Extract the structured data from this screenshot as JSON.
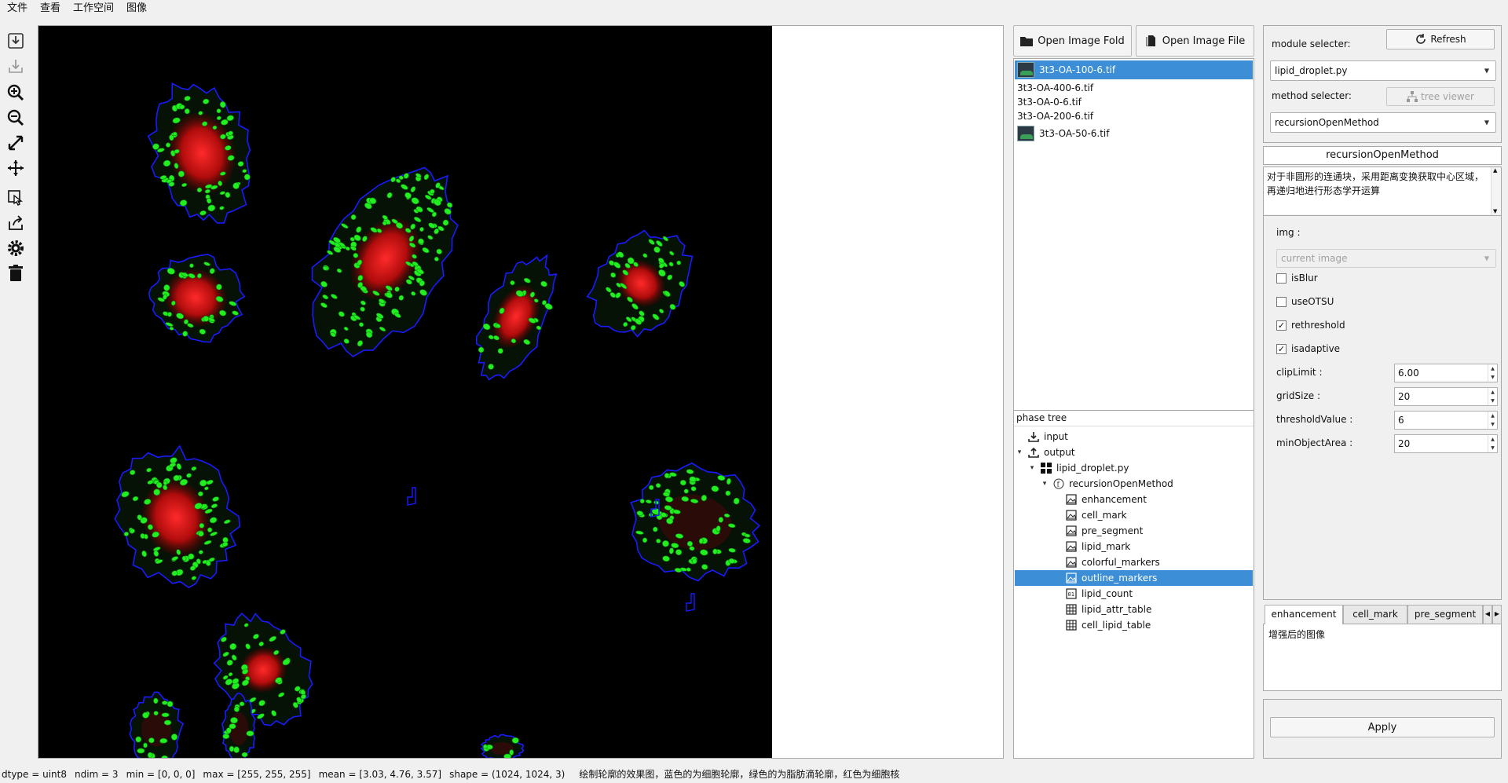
{
  "menu": [
    "文件",
    "查看",
    "工作空间",
    "图像"
  ],
  "toolbar": [
    {
      "icon": "import-icon"
    },
    {
      "icon": "export-icon"
    },
    {
      "icon": "zoom-in-icon"
    },
    {
      "icon": "zoom-out-icon"
    },
    {
      "icon": "fit-icon"
    },
    {
      "icon": "move-icon"
    },
    {
      "icon": "hand-select-icon"
    },
    {
      "icon": "share-icon"
    },
    {
      "icon": "settings-icon"
    },
    {
      "icon": "trash-icon"
    }
  ],
  "buttons": {
    "open_fold": "Open Image Fold",
    "open_file": "Open Image File"
  },
  "files": [
    {
      "name": "3t3-OA-100-6.tif",
      "thumb": true,
      "selected": true
    },
    {
      "name": "3t3-OA-400-6.tif",
      "thumb": false,
      "selected": false
    },
    {
      "name": "3t3-OA-0-6.tif",
      "thumb": false,
      "selected": false
    },
    {
      "name": "3t3-OA-200-6.tif",
      "thumb": false,
      "selected": false
    },
    {
      "name": "3t3-OA-50-6.tif",
      "thumb": true,
      "selected": false
    }
  ],
  "phase_tree": {
    "header": "phase tree",
    "nodes": [
      {
        "label": "input",
        "icon": "import-icon",
        "level": 1,
        "arrow": ""
      },
      {
        "label": "output",
        "icon": "export-icon",
        "level": 1,
        "arrow": "▾"
      },
      {
        "label": "lipid_droplet.py",
        "icon": "module-icon",
        "level": 2,
        "arrow": "▾"
      },
      {
        "label": "recursionOpenMethod",
        "icon": "function-icon",
        "level": 3,
        "arrow": "▾"
      },
      {
        "label": "enhancement",
        "icon": "image-icon",
        "level": 4,
        "arrow": ""
      },
      {
        "label": "cell_mark",
        "icon": "image-icon",
        "level": 4,
        "arrow": ""
      },
      {
        "label": "pre_segment",
        "icon": "image-icon",
        "level": 4,
        "arrow": ""
      },
      {
        "label": "lipid_mark",
        "icon": "image-icon",
        "level": 4,
        "arrow": ""
      },
      {
        "label": "colorful_markers",
        "icon": "image-icon",
        "level": 4,
        "arrow": ""
      },
      {
        "label": "outline_markers",
        "icon": "image-icon",
        "level": 4,
        "arrow": "",
        "selected": true
      },
      {
        "label": "lipid_count",
        "icon": "number-icon",
        "level": 4,
        "arrow": ""
      },
      {
        "label": "lipid_attr_table",
        "icon": "table-icon",
        "level": 4,
        "arrow": ""
      },
      {
        "label": "cell_lipid_table",
        "icon": "table-icon",
        "level": 4,
        "arrow": ""
      }
    ]
  },
  "module": {
    "module_label": "module selecter:",
    "refresh": "Refresh",
    "module_value": "lipid_droplet.py",
    "method_label": "method selecter:",
    "tree_viewer": "tree viewer",
    "method_value": "recursionOpenMethod"
  },
  "method_title": "recursionOpenMethod",
  "method_desc": "对于非圆形的连通块，采用距离变换获取中心区域，再递归地进行形态学开运算",
  "params": {
    "img_label": "img :",
    "img_value": "current image",
    "checks": [
      {
        "label": "isBlur",
        "checked": false
      },
      {
        "label": "useOTSU",
        "checked": false
      },
      {
        "label": "rethreshold",
        "checked": true
      },
      {
        "label": "isadaptive",
        "checked": true
      }
    ],
    "spins": [
      {
        "label": "clipLimit :",
        "value": "6.00"
      },
      {
        "label": "gridSize :",
        "value": "20"
      },
      {
        "label": "thresholdValue :",
        "value": "6"
      },
      {
        "label": "minObjectArea :",
        "value": "20"
      }
    ]
  },
  "output_tabs": [
    "enhancement",
    "cell_mark",
    "pre_segment"
  ],
  "output_desc": "增强后的图像",
  "apply": "Apply",
  "status": {
    "dtype": "dtype = uint8",
    "ndim": "ndim = 3",
    "min": "min = [0, 0, 0]",
    "max": "max = [255, 255, 255]",
    "mean": "mean = [3.03, 4.76, 3.57]",
    "shape": "shape = (1024, 1024, 3)",
    "message": "绘制轮廓的效果图，蓝色的为细胞轮廓，绿色的为脂肪滴轮廓，红色为细胞核"
  },
  "colors": {
    "accent": "#3c8ed6",
    "cell_outline": "#1a1aff",
    "lipid": "#22ee22",
    "nucleus": "#cc1010"
  }
}
